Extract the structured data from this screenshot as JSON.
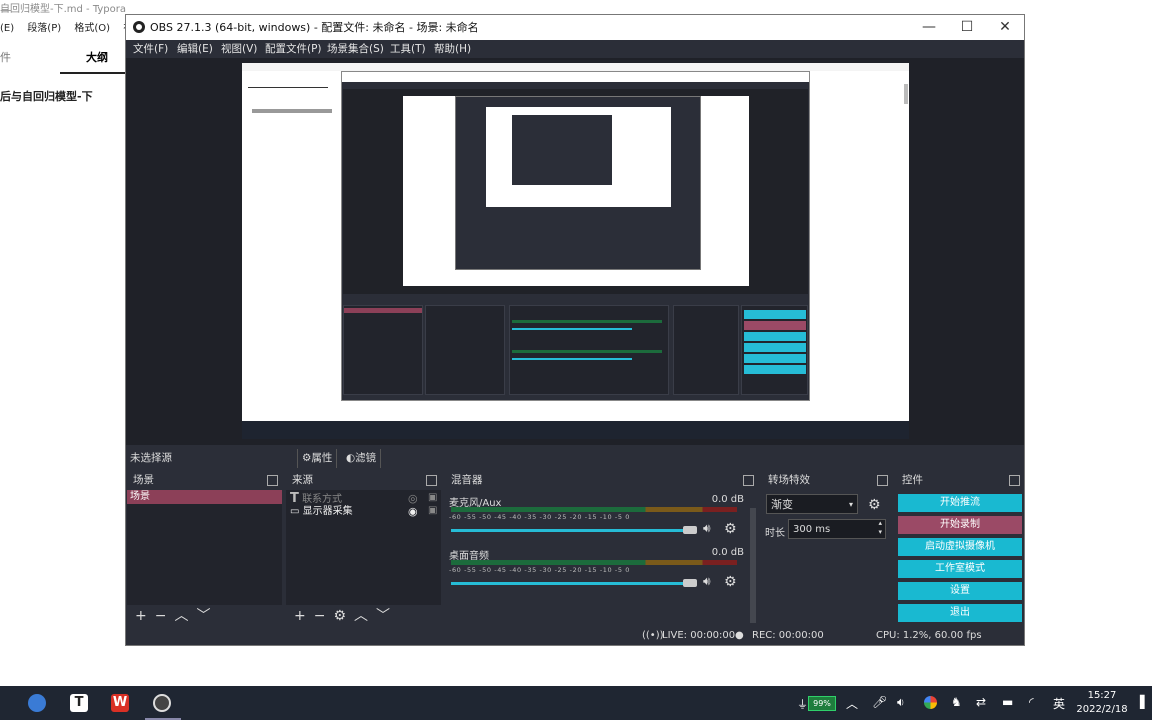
{
  "typora": {
    "title": "自回归模型-下.md - Typora",
    "menu": [
      "(E)",
      "段落(P)",
      "格式(O)",
      "视"
    ],
    "tabs": {
      "file": "件",
      "outline": "大纲"
    },
    "outline_item": "后与自回归模型-下"
  },
  "obs": {
    "title": "OBS 27.1.3 (64-bit, windows) - 配置文件: 未命名 - 场景: 未命名",
    "window_buttons": {
      "minimize": "—",
      "maximize": "☐",
      "close": "✕"
    },
    "menu": [
      "文件(F)",
      "编辑(E)",
      "视图(V)",
      "配置文件(P)",
      "场景集合(S)",
      "工具(T)",
      "帮助(H)"
    ],
    "source_bar": {
      "no_source": "未选择源",
      "properties": "属性",
      "filters": "滤镜"
    },
    "scenes": {
      "title": "场景",
      "items": [
        "场景"
      ]
    },
    "sources": {
      "title": "来源",
      "items": [
        "联系方式",
        "显示器采集"
      ]
    },
    "mixer": {
      "title": "混音器",
      "ticks": "-60 -55 -50 -45 -40 -35 -30 -25 -20 -15 -10 -5 0",
      "channels": [
        {
          "name": "麦克风/Aux",
          "db": "0.0 dB"
        },
        {
          "name": "桌面音频",
          "db": "0.0 dB"
        }
      ]
    },
    "transitions": {
      "title": "转场特效",
      "selected": "渐变",
      "duration_label": "时长",
      "duration": "300 ms"
    },
    "controls": {
      "title": "控件",
      "start_stream": "开始推流",
      "start_record": "开始录制",
      "virtual_cam": "启动虚拟摄像机",
      "studio_mode": "工作室模式",
      "settings": "设置",
      "exit": "退出"
    },
    "status": {
      "live": "LIVE: 00:00:00",
      "rec": "REC: 00:00:00",
      "cpu": "CPU: 1.2%, 60.00 fps"
    }
  },
  "taskbar": {
    "battery": "99%",
    "ime": "英",
    "time": "15:27",
    "date": "2022/2/18"
  }
}
